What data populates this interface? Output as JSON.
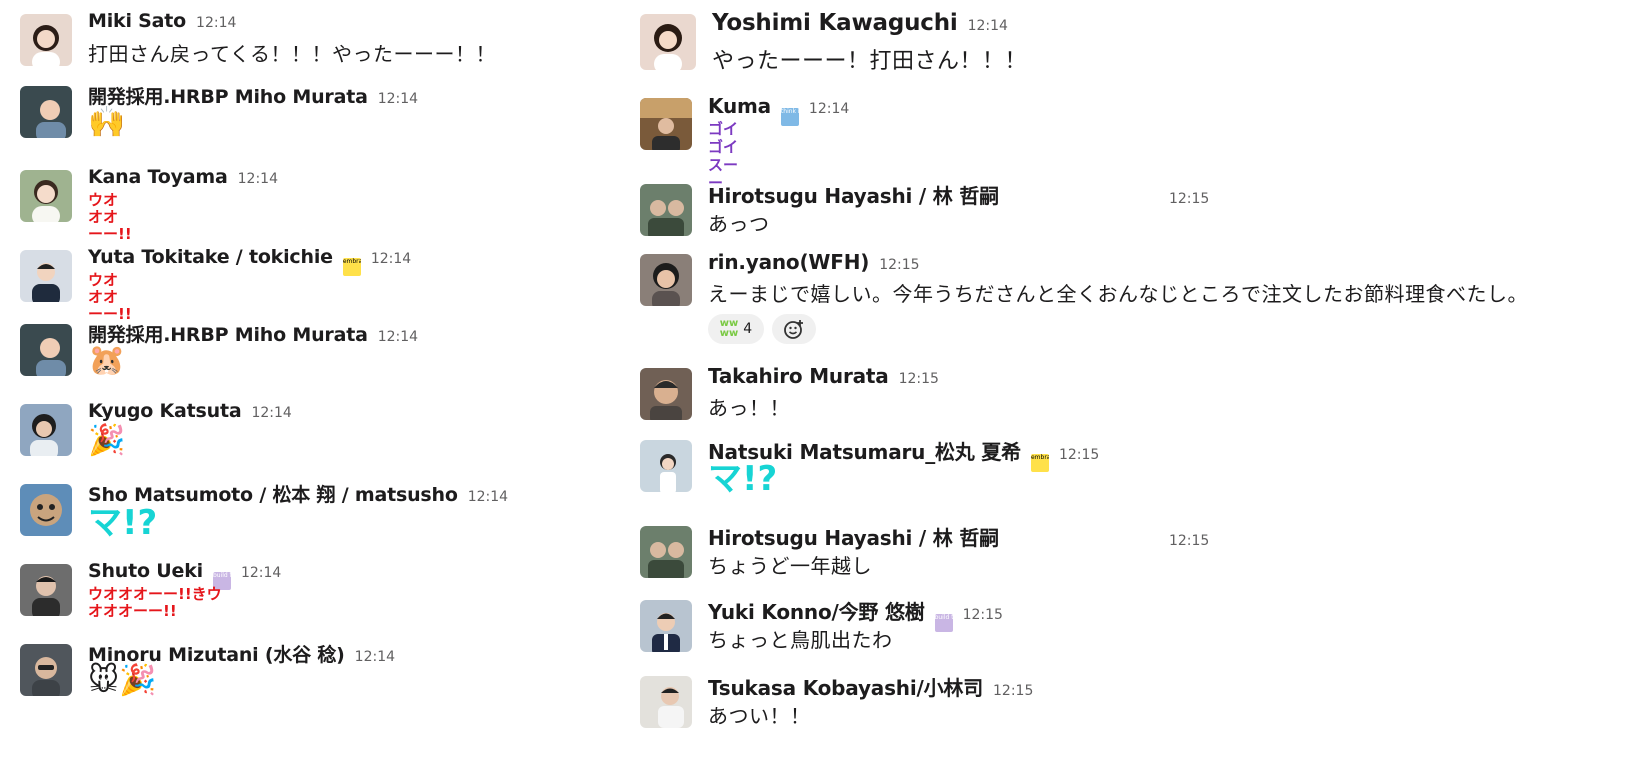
{
  "left_messages": [
    {
      "name": "Miki Sato",
      "time": "12:14",
      "text": "打田さん戻ってくる！！！やったーーー！！",
      "avatar_color": "#e8d8cf"
    },
    {
      "name": "開発採用.HRBP Miho Murata",
      "time": "12:14",
      "emoji": "🙌",
      "avatar_color": "#3a4a4f"
    },
    {
      "name": "Kana Toyama",
      "time": "12:14",
      "emoji": "ウオオオーー!!",
      "avatar_color": "#9fb390"
    },
    {
      "name": "Yuta Tokitake / tokichie",
      "time": "12:14",
      "badge": "embrace the future",
      "emoji": "ウオオオーー!!",
      "avatar_color": "#d7dde5"
    },
    {
      "name": "開発採用.HRBP Miho Murata",
      "time": "12:14",
      "emoji": "🐹",
      "avatar_color": "#3a4a4f"
    },
    {
      "name": "Kyugo Katsuta",
      "time": "12:14",
      "emoji": "🎉",
      "avatar_color": "#8fa6c0"
    },
    {
      "name": "Sho Matsumoto / 松本 翔 / matsusho",
      "time": "12:14",
      "emoji": "マ!?",
      "avatar_color": "#5e8db8"
    },
    {
      "name": "Shuto Ueki",
      "time": "12:14",
      "badge": "build trust",
      "emoji": "ウオオオーー!!きウオオオーー!!",
      "avatar_color": "#6d6d6d"
    },
    {
      "name": "Minoru Mizutani (水谷 稔)",
      "time": "12:14",
      "emoji": "🐭🎉",
      "avatar_color": "#50565c"
    }
  ],
  "right_messages": [
    {
      "name": "Yoshimi Kawaguchi",
      "time": "12:14",
      "text": "やったーーー！打田さん！！！",
      "avatar_color": "#ead8cf"
    },
    {
      "name": "Kuma",
      "time": "12:14",
      "badge": "think big, aim high",
      "emoji": "ゴイゴイスーー",
      "avatar_color": "#7a5a3a"
    },
    {
      "name": "Hirotsugu Hayashi / 林 哲嗣",
      "time": "12:15",
      "text": "あっつ",
      "avatar_color": "#6c7f6c"
    },
    {
      "name": "rin.yano(WFH)",
      "time": "12:15",
      "text": "えーまじで嬉しい。今年うちださんと全くおんなじところで注文したお節料理食べたし。",
      "avatar_color": "#8a7f78",
      "reaction_count": "4"
    },
    {
      "name": "Takahiro Murata",
      "time": "12:15",
      "text": "あっ！！",
      "avatar_color": "#706055"
    },
    {
      "name": "Natsuki Matsumaru_松丸 夏希",
      "time": "12:15",
      "badge": "embrace the future",
      "emoji": "マ!?",
      "avatar_color": "#c9d6df"
    },
    {
      "name": "Hirotsugu Hayashi / 林 哲嗣",
      "time": "12:15",
      "text": "ちょうど一年越し",
      "avatar_color": "#6c7f6c"
    },
    {
      "name": "Yuki Konno/今野 悠樹",
      "time": "12:15",
      "badge": "build trust",
      "text": "ちょっと鳥肌出たわ",
      "avatar_color": "#b8c4d0"
    },
    {
      "name": "Tsukasa Kobayashi/小林司",
      "time": "12:15",
      "text": "あつい！！",
      "avatar_color": "#e3e1dc"
    }
  ],
  "colors": {
    "red_text_emoji": "#e5161b",
    "cyan_text_emoji": "#17d4d4",
    "purple_text_emoji": "#7c3ac1",
    "time": "#616061"
  }
}
